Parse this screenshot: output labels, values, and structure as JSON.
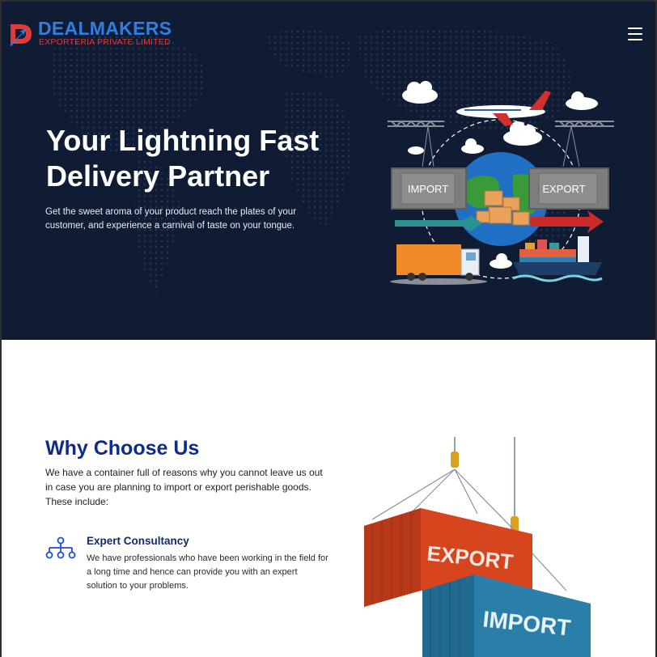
{
  "brand": {
    "name": "DEALMAKERS",
    "subtitle": "EXPORTERIA PRIVATE LIMITED"
  },
  "hero": {
    "title": "Your Lightning Fast Delivery Partner",
    "description": "Get the sweet aroma of your product reach the plates of your customer, and experience a carnival of taste on your tongue.",
    "illustration": {
      "import_label": "IMPORT",
      "export_label": "EXPORT"
    }
  },
  "why_choose_us": {
    "title": "Why Choose Us",
    "description": "We have a container full of reasons why you cannot leave us out in case you are planning to import or export perishable goods. These include:",
    "features": [
      {
        "icon": "sitemap-icon",
        "title": "Expert Consultancy",
        "description": "We have professionals who have been working in the field for a long time and hence can provide you with an expert solution to your problems."
      }
    ],
    "illustration": {
      "export_label": "EXPORT",
      "import_label": "IMPORT"
    }
  },
  "colors": {
    "hero_background": "#101c34",
    "heading_blue": "#0f2c8c",
    "brand_blue": "#2f7fe0",
    "brand_red": "#e03a3a"
  }
}
